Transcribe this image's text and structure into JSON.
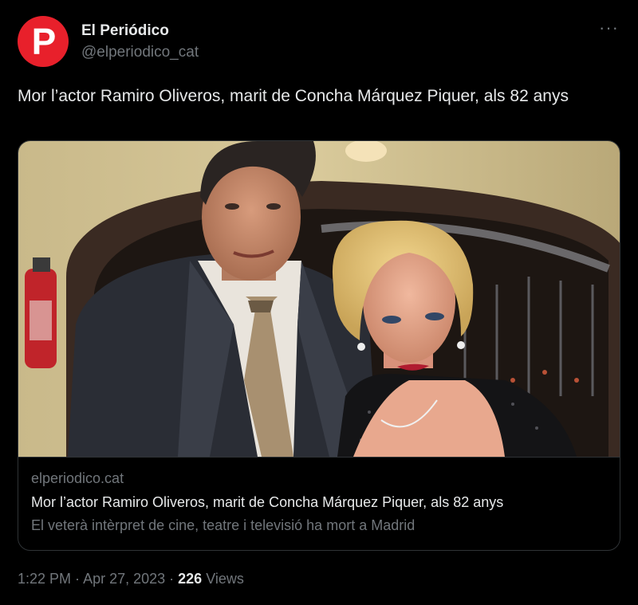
{
  "account": {
    "avatar_letter": "P",
    "display_name": "El Periódico",
    "handle": "@elperiodico_cat",
    "brand_color": "#e8202b"
  },
  "more_icon": "more-horizontal-icon",
  "more_glyph": "···",
  "tweet": {
    "text": "Mor l’actor Ramiro Oliveros, marit de Concha Márquez Piquer, als 82 anys"
  },
  "card": {
    "domain": "elperiodico.cat",
    "title": "Mor l’actor Ramiro Oliveros, marit de Concha Márquez Piquer, als 82 anys",
    "description": "El veterà intèrpret de cine, teatre i televisió ha mort a Madrid"
  },
  "meta": {
    "time": "1:22 PM",
    "separator": " · ",
    "date": "Apr 27, 2023",
    "views_count": "226",
    "views_label": "Views"
  }
}
